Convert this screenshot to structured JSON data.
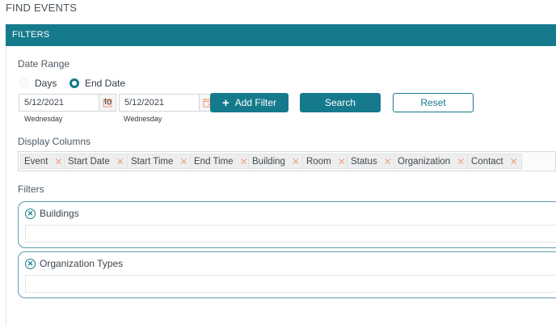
{
  "page": {
    "title": "FIND EVENTS"
  },
  "filters_bar": {
    "title": "FILTERS"
  },
  "date_range": {
    "label": "Date Range",
    "modes": [
      {
        "label": "Days",
        "selected": false
      },
      {
        "label": "End Date",
        "selected": true
      }
    ],
    "start": {
      "value": "5/12/2021",
      "weekday": "Wednesday"
    },
    "separator": "to",
    "end": {
      "value": "5/12/2021",
      "weekday": "Wednesday"
    }
  },
  "buttons": {
    "add_filter": "Add Filter",
    "search": "Search",
    "reset": "Reset"
  },
  "display_columns": {
    "label": "Display Columns",
    "items": [
      "Event",
      "Start Date",
      "Start Time",
      "End Time",
      "Building",
      "Room",
      "Status",
      "Organization",
      "Contact"
    ],
    "remove_glyph": "✕"
  },
  "filters": {
    "label": "Filters",
    "groups": [
      {
        "label": "Buildings",
        "value": ""
      },
      {
        "label": "Organization Types",
        "value": ""
      }
    ],
    "remove_glyph": "✕"
  },
  "colors": {
    "accent": "#157a8c",
    "chip_remove": "#f0a486"
  }
}
